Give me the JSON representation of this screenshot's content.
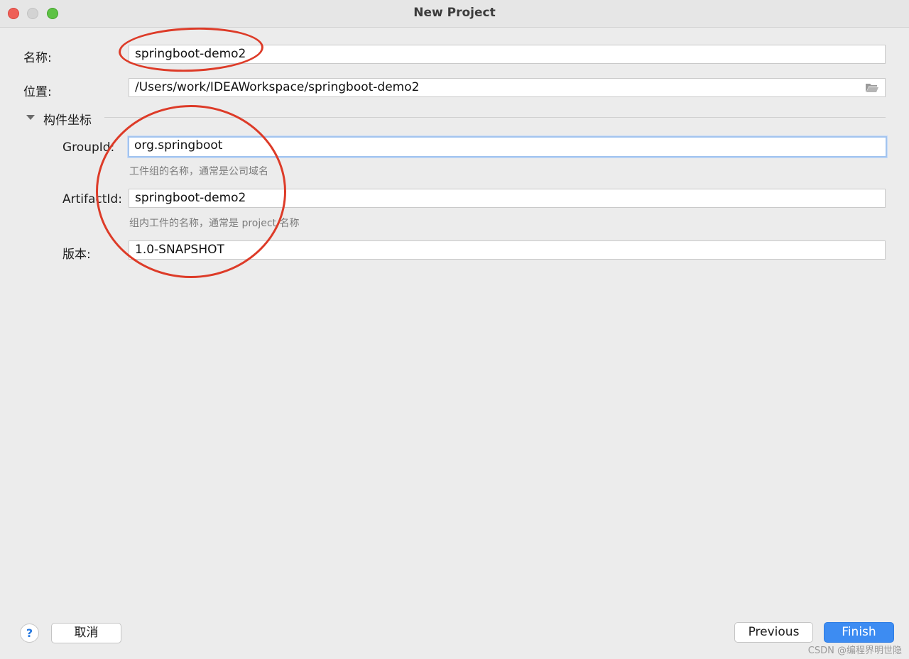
{
  "window": {
    "title": "New Project"
  },
  "form": {
    "name_label": "名称:",
    "name_value": "springboot-demo2",
    "location_label": "位置:",
    "location_value": "/Users/work/IDEAWorkspace/springboot-demo2",
    "section_label": "构件坐标",
    "groupid_label": "GroupId:",
    "groupid_value": "org.springboot",
    "groupid_hint": "工件组的名称，通常是公司域名",
    "artifactid_label": "ArtifactId:",
    "artifactid_value": "springboot-demo2",
    "artifactid_hint": "组内工件的名称，通常是 project 名称",
    "version_label": "版本:",
    "version_value": "1.0-SNAPSHOT"
  },
  "footer": {
    "help_label": "?",
    "cancel_label": "取消",
    "previous_label": "Previous",
    "finish_label": "Finish",
    "watermark": "CSDN @编程界明世隐"
  },
  "colors": {
    "annotation": "#dd3b28",
    "primary": "#3d8cf2",
    "focus": "#a3c4ef"
  },
  "icons": {
    "folder": "folder-open-icon",
    "disclosure": "triangle-down-icon",
    "help": "help-icon"
  }
}
